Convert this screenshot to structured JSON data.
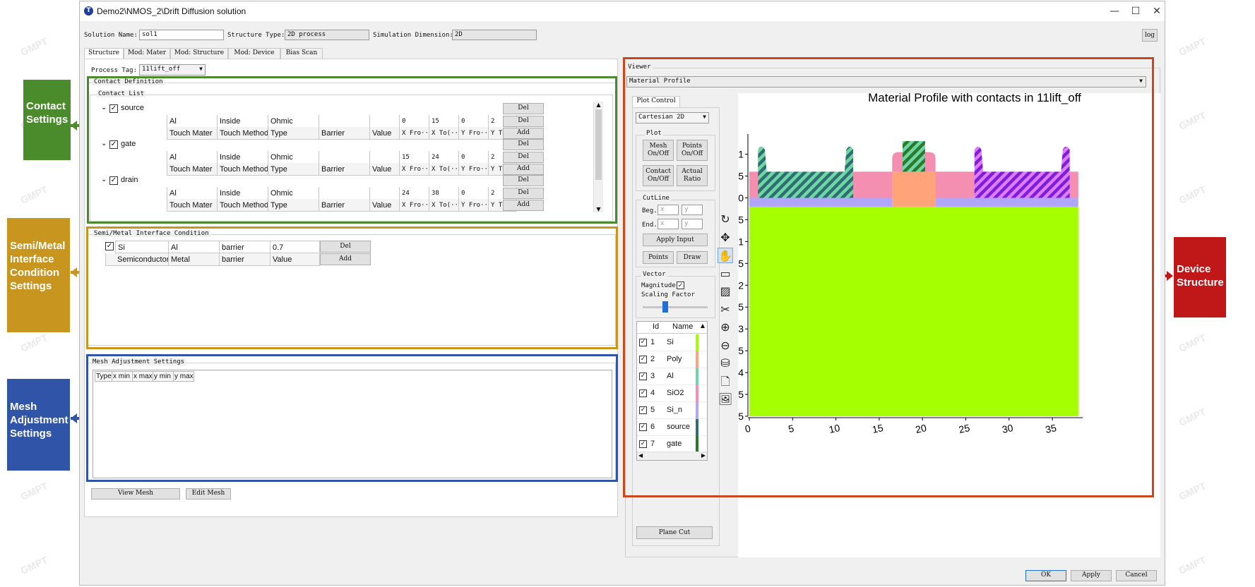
{
  "window": {
    "title": "Demo2\\NMOS_2\\Drift Diffusion solution",
    "app_icon_letter": "T"
  },
  "header": {
    "solution_name_label": "Solution Name:",
    "solution_name_value": "sol1",
    "structure_type_label": "Structure Type:",
    "structure_type_value": "2D process",
    "sim_dim_label": "Simulation Dimension:",
    "sim_dim_value": "2D",
    "log_button": "log"
  },
  "tabs": [
    "Structure",
    "Mod: Mater",
    "Mod: Structure",
    "Mod: Device",
    "Bias Scan"
  ],
  "process_tag": {
    "label": "Process Tag:",
    "value": "11lift_off"
  },
  "contact_definition": {
    "group_label": "Contact Definition",
    "list_label": "Contact List",
    "contacts": [
      {
        "name": "source",
        "values": [
          "Al",
          "Inside",
          "Ohmic",
          "",
          "",
          "0",
          "15",
          "0",
          "2"
        ]
      },
      {
        "name": "gate",
        "values": [
          "Al",
          "Inside",
          "Ohmic",
          "",
          "",
          "15",
          "24",
          "0",
          "2"
        ]
      },
      {
        "name": "drain",
        "values": [
          "Al",
          "Inside",
          "Ohmic",
          "",
          "",
          "24",
          "38",
          "0",
          "2"
        ]
      }
    ],
    "header_cells": [
      "Touch Mater",
      "Touch Method",
      "Type",
      "Barrier",
      "Value",
      "X Fro···",
      "X To(···",
      "Y Fro···",
      "Y To(···"
    ],
    "del_label": "Del",
    "add_label": "Add"
  },
  "semi_metal": {
    "group_label": "Semi/Metal Interface Condition",
    "row": [
      "Si",
      "Al",
      "barrier",
      "0.7"
    ],
    "header": [
      "Semiconductor",
      "Metal",
      "barrier",
      "Value"
    ],
    "del_label": "Del",
    "add_label": "Add"
  },
  "mesh": {
    "group_label": "Mesh Adjustment Settings",
    "columns": [
      "Type",
      "x min",
      "x max",
      "y min",
      "y max"
    ],
    "view_mesh": "View Mesh",
    "edit_mesh": "Edit Mesh"
  },
  "viewer": {
    "group_label": "Viewer",
    "profile_select": "Material Profile",
    "plot_control_tab": "Plot Control",
    "coord_select": "Cartesian 2D",
    "plot_label": "Plot",
    "mesh_btn": [
      "Mesh",
      "On/Off"
    ],
    "points_btn": [
      "Points",
      "On/Off"
    ],
    "contact_btn": [
      "Contact",
      "On/Off"
    ],
    "ratio_btn": [
      "Actual",
      "Ratio"
    ],
    "cutline_label": "CutLine",
    "beg_label": "Beg.",
    "end_label": "End.",
    "x_placeholder": "x",
    "y_placeholder": "y",
    "apply_input": "Apply Input",
    "points_label": "Points",
    "draw_label": "Draw",
    "vector_label": "Vector",
    "magnitude_label": "Magnitude",
    "scaling_label": "Scaling Factor",
    "scaling_value": 0.35,
    "table_header": [
      "Id",
      "Name"
    ],
    "materials": [
      {
        "id": "1",
        "name": "Si",
        "color": "#a6ff00"
      },
      {
        "id": "2",
        "name": "Poly",
        "color": "#ffa37a"
      },
      {
        "id": "3",
        "name": "Al",
        "color": "#6fd6a6"
      },
      {
        "id": "4",
        "name": "SiO2",
        "color": "#f48fb1"
      },
      {
        "id": "5",
        "name": "Si_n",
        "color": "#b0a6ff"
      },
      {
        "id": "6",
        "name": "source",
        "color": "#2f6f72"
      },
      {
        "id": "7",
        "name": "gate",
        "color": "#2b7a2b"
      }
    ],
    "plane_cut": "Plane Cut",
    "plot_title": "Material Profile with contacts in 11lift_off",
    "tools": [
      "rotate-icon",
      "move-icon",
      "hand-icon",
      "rectangle-icon",
      "hatch-icon",
      "scissors-icon",
      "zoom-in-icon",
      "zoom-out-icon",
      "cylinder-icon",
      "document-icon",
      "image-icon"
    ]
  },
  "chart_data": {
    "type": "heatmap",
    "title": "Material Profile with contacts in 11lift_off",
    "x_ticks": [
      "0",
      "5",
      "10",
      "15",
      "20",
      "25",
      "30",
      "35"
    ],
    "y_ticks": [
      "1",
      ".5",
      "0",
      ".5",
      "-1",
      ".5",
      "-2",
      ".5",
      "-3",
      ".5",
      "-4",
      ".5",
      "-5"
    ],
    "xlim": [
      0,
      38.5
    ],
    "ylim": [
      -5,
      1.3
    ]
  },
  "footer": {
    "ok": "OK",
    "apply": "Apply",
    "cancel": "Cancel"
  },
  "annotations": {
    "contact": [
      "Contact",
      "Settings"
    ],
    "semi": [
      "Semi/Metal",
      "Interface",
      "Condition",
      "Settings"
    ],
    "mesh": [
      "Mesh",
      "Adjustment",
      "Settings"
    ],
    "device": [
      "Device",
      "Structure"
    ],
    "colors": {
      "green": "#4a8c2c",
      "gold": "#c8961e",
      "blue": "#2f54a8",
      "red": "#c01818"
    }
  },
  "watermark": "GMPT"
}
